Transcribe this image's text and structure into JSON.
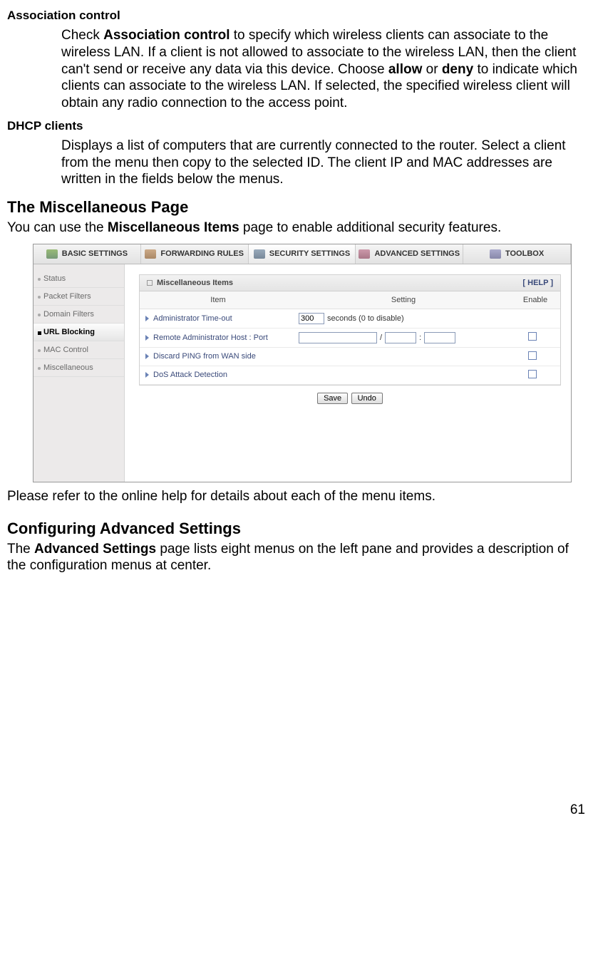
{
  "sections": {
    "assoc_label": "Association control",
    "assoc_body_1": "Check ",
    "assoc_body_bold1": "Association control",
    "assoc_body_2": " to specify which wireless clients can associate to the wireless LAN. If a client is not allowed to associate to the wireless LAN, then the client can't send or receive any data via this device. Choose ",
    "assoc_body_bold2": "allow",
    "assoc_body_3": " or ",
    "assoc_body_bold3": "deny",
    "assoc_body_4": " to indicate which clients can associate to the wireless LAN. If selected, the specified wireless client will obtain any radio connection to the access point.",
    "dhcp_label": "DHCP clients",
    "dhcp_body": "Displays a list of computers that are currently connected to the router. Select a client from the menu then copy to the selected ID. The client IP and MAC addresses are written in the fields below the menus."
  },
  "misc": {
    "heading": "The Miscellaneous Page",
    "lead_1": "You can use the ",
    "lead_bold": "Miscellaneous Items",
    "lead_2": " page to enable additional security features.",
    "after": "Please refer to the online help for details about each of the menu items."
  },
  "adv": {
    "heading": "Configuring Advanced Settings",
    "lead_1": "The ",
    "lead_bold": "Advanced Settings",
    "lead_2": " page lists eight menus on the left pane and provides a description of the configuration menus at center."
  },
  "ui": {
    "tabs": [
      "BASIC SETTINGS",
      "FORWARDING RULES",
      "SECURITY SETTINGS",
      "ADVANCED SETTINGS",
      "TOOLBOX"
    ],
    "side": [
      "Status",
      "Packet Filters",
      "Domain Filters",
      "URL Blocking",
      "MAC Control",
      "Miscellaneous"
    ],
    "panel_title": "Miscellaneous Items",
    "help": "[ HELP ]",
    "cols": {
      "item": "Item",
      "setting": "Setting",
      "enable": "Enable"
    },
    "rows": {
      "timeout_label": "Administrator Time-out",
      "timeout_value": "300",
      "timeout_suffix": "seconds (0 to disable)",
      "remote_label": "Remote Administrator Host : Port",
      "remote_host": "",
      "remote_sep1": "/",
      "remote_port1": "",
      "remote_sep2": ":",
      "remote_port2": "",
      "ping_label": "Discard PING from WAN side",
      "dos_label": "DoS Attack Detection"
    },
    "buttons": {
      "save": "Save",
      "undo": "Undo"
    }
  },
  "page_number": "61"
}
